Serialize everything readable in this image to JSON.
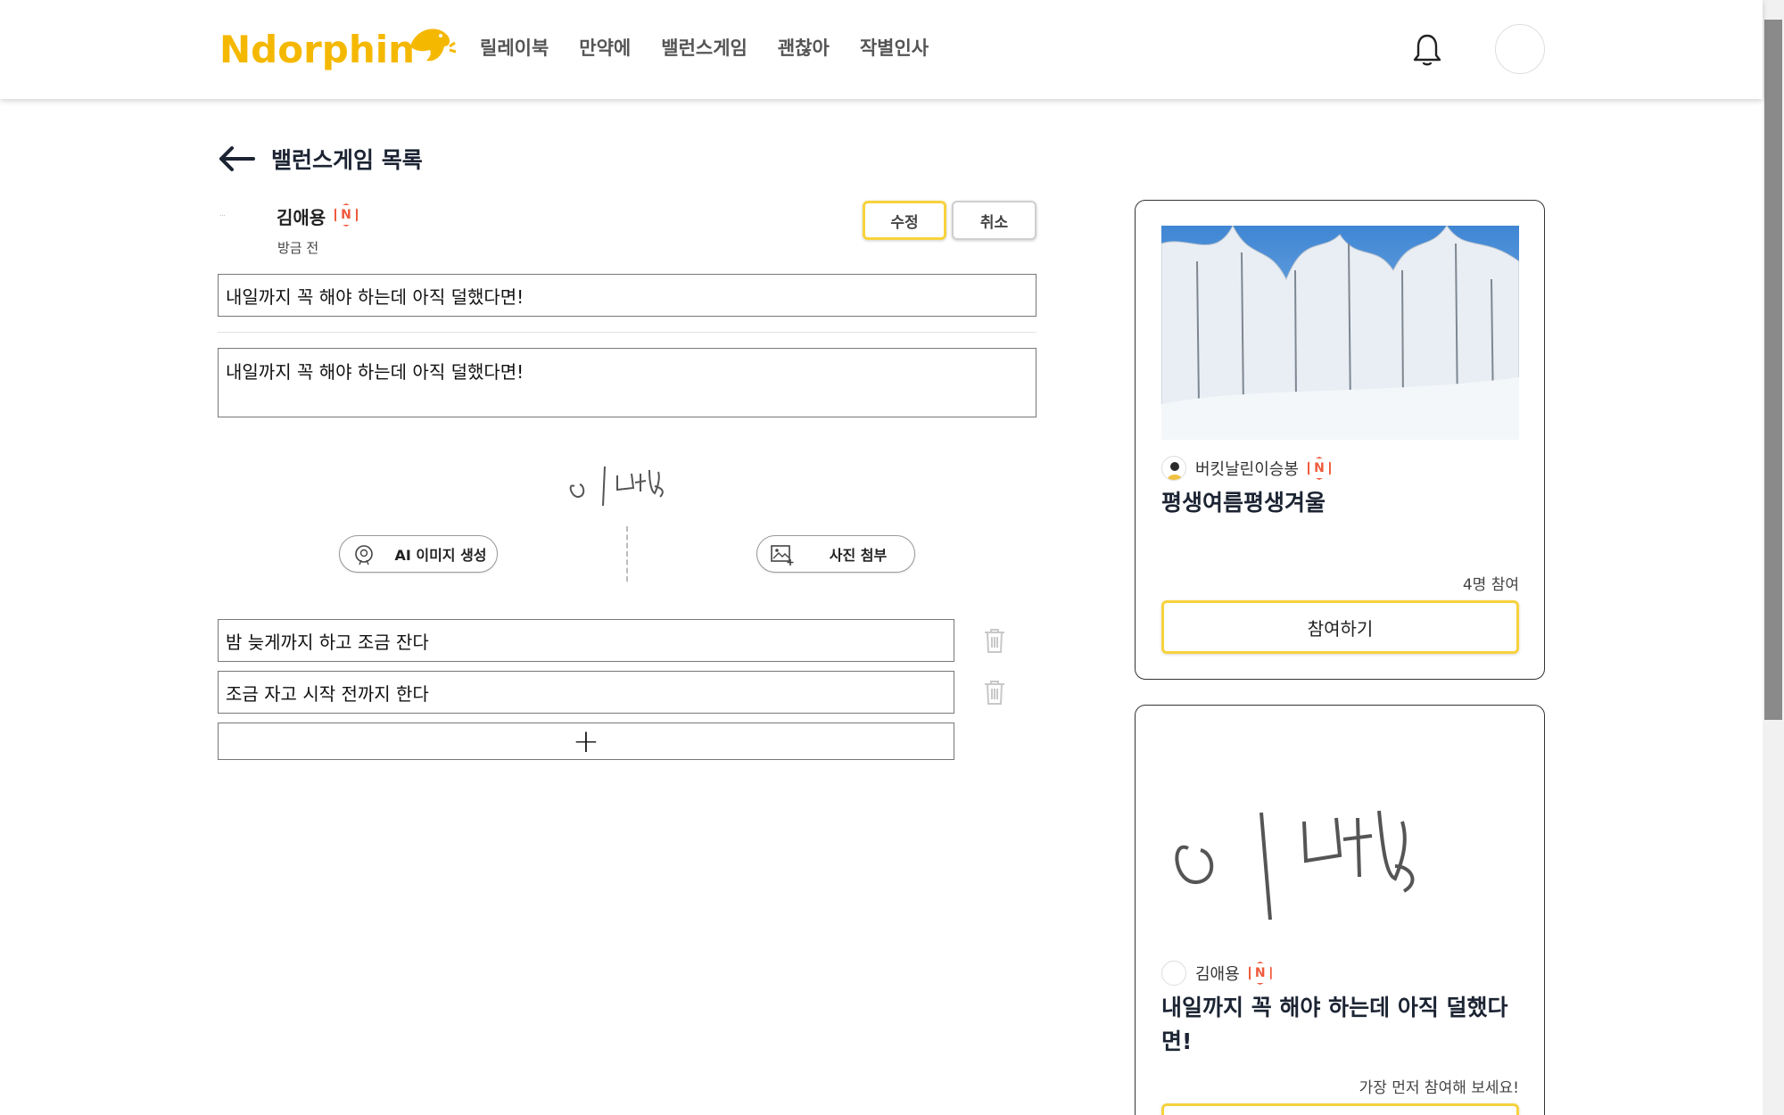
{
  "header": {
    "logo": "Ndorphin",
    "nav": [
      "릴레이북",
      "만약에",
      "밸런스게임",
      "괜찮아",
      "작별인사"
    ]
  },
  "page": {
    "back_title": "밸런스게임 목록"
  },
  "post": {
    "author": "김애용",
    "badge": "N",
    "time": "방금 전",
    "edit_label": "수정",
    "cancel_label": "취소",
    "title_value": "내일까지 꼭 해야 하는데 아직 덜했다면!",
    "content_value": "내일까지 꼭 해야 하는데 아직 덜했다면!",
    "ai_image_label": "AI 이미지 생성",
    "photo_label": "사진 첨부",
    "options": [
      "밤 늦게까지 하고 조금 잔다",
      "조금 자고 시작 전까지 한다"
    ],
    "add_option_label": "+"
  },
  "cards": [
    {
      "author": "버킷날린이승봉",
      "badge": "N",
      "title": "평생여름평생겨울",
      "meta": "4명 참여",
      "button": "참여하기"
    },
    {
      "author": "김애용",
      "badge": "N",
      "title": "내일까지 꼭 해야 하는데 아직 덜했다면!",
      "meta": "가장 먼저 참여해 보세요!"
    }
  ],
  "colors": {
    "accent_yellow": "#f7d23d",
    "badge_red": "#ef5a3c",
    "logo_yellow": "#f5b800"
  }
}
